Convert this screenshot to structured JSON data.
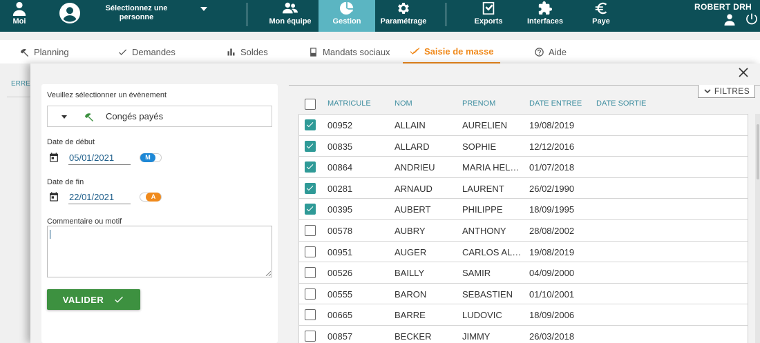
{
  "topbar": {
    "moi_label": "Moi",
    "selector_label": "Sélectionnez une personne",
    "nav": [
      {
        "label": "Mon équipe",
        "icon": "team-icon"
      },
      {
        "label": "Gestion",
        "icon": "pie-chart-icon"
      },
      {
        "label": "Paramétrage",
        "icon": "gear-icon"
      },
      {
        "label": "Exports",
        "icon": "checkbox-icon"
      },
      {
        "label": "Interfaces",
        "icon": "puzzle-icon"
      },
      {
        "label": "Paye",
        "icon": "euro-icon"
      }
    ],
    "user_name": "ROBERT DRH"
  },
  "tabs": [
    {
      "label": "Planning",
      "icon": "beach-icon"
    },
    {
      "label": "Demandes",
      "icon": "check-icon"
    },
    {
      "label": "Soldes",
      "icon": "bar-chart-icon"
    },
    {
      "label": "Mandats sociaux",
      "icon": "badge-icon"
    },
    {
      "label": "Saisie de masse",
      "icon": "double-check-icon"
    },
    {
      "label": "Aide",
      "icon": "help-icon"
    }
  ],
  "behind": {
    "text": "ERREU"
  },
  "form": {
    "event_label": "Veuillez sélectionner un évènement",
    "event_value": "Congés payés",
    "start_label": "Date de début",
    "start_value": "05/01/2021",
    "start_toggle": "M",
    "end_label": "Date de fin",
    "end_value": "22/01/2021",
    "end_toggle": "A",
    "comment_label": "Commentaire ou motif",
    "comment_value": "",
    "submit_label": "VALIDER"
  },
  "table": {
    "filters_label": "FILTRES",
    "headers": [
      "MATRICULE",
      "NOM",
      "PRENOM",
      "DATE ENTREE",
      "DATE SORTIE"
    ],
    "rows": [
      {
        "checked": true,
        "matricule": "00952",
        "nom": "ALLAIN",
        "prenom": "AURELIEN",
        "entree": "19/08/2019",
        "sortie": ""
      },
      {
        "checked": true,
        "matricule": "00835",
        "nom": "ALLARD",
        "prenom": "SOPHIE",
        "entree": "12/12/2016",
        "sortie": ""
      },
      {
        "checked": true,
        "matricule": "00864",
        "nom": "ANDRIEU",
        "prenom": "MARIA HELE…",
        "entree": "01/07/2018",
        "sortie": ""
      },
      {
        "checked": true,
        "matricule": "00281",
        "nom": "ARNAUD",
        "prenom": "LAURENT",
        "entree": "26/02/1990",
        "sortie": ""
      },
      {
        "checked": true,
        "matricule": "00395",
        "nom": "AUBERT",
        "prenom": "PHILIPPE",
        "entree": "18/09/1995",
        "sortie": ""
      },
      {
        "checked": false,
        "matricule": "00578",
        "nom": "AUBRY",
        "prenom": "ANTHONY",
        "entree": "28/08/2002",
        "sortie": ""
      },
      {
        "checked": false,
        "matricule": "00951",
        "nom": "AUGER",
        "prenom": "CARLOS ALB…",
        "entree": "19/08/2019",
        "sortie": ""
      },
      {
        "checked": false,
        "matricule": "00526",
        "nom": "BAILLY",
        "prenom": "SAMIR",
        "entree": "04/09/2000",
        "sortie": ""
      },
      {
        "checked": false,
        "matricule": "00555",
        "nom": "BARON",
        "prenom": "SEBASTIEN",
        "entree": "01/10/2001",
        "sortie": ""
      },
      {
        "checked": false,
        "matricule": "00665",
        "nom": "BARRE",
        "prenom": "LUDOVIC",
        "entree": "18/09/2006",
        "sortie": ""
      },
      {
        "checked": false,
        "matricule": "00857",
        "nom": "BECKER",
        "prenom": "JIMMY",
        "entree": "26/03/2018",
        "sortie": ""
      }
    ]
  },
  "colors": {
    "topbar": "#0d4f57",
    "active_nav": "#5bb5c2",
    "accent_orange": "#f08a1c",
    "check_teal": "#2f9a97",
    "valider_green": "#3d9140",
    "toggle_blue": "#1e88d6"
  }
}
